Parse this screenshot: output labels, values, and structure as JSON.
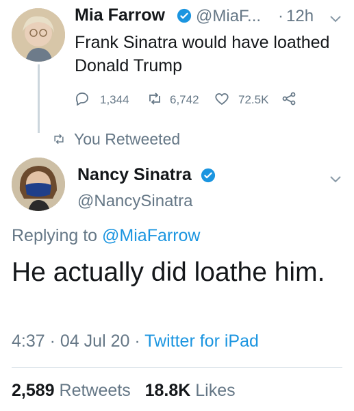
{
  "colors": {
    "accent": "#1b95e0",
    "muted": "#657786",
    "text": "#14171a",
    "divider": "#e1e8ed"
  },
  "tweet1": {
    "author_name": "Mia Farrow",
    "handle": "@MiaF...",
    "separator": "·",
    "time": "12h",
    "text": "Frank Sinatra would have loathed Donald Trump",
    "replies": "1,344",
    "retweets": "6,742",
    "likes": "72.5K",
    "icons": [
      "reply-icon",
      "retweet-icon",
      "like-icon",
      "share-icon",
      "verified-badge-icon",
      "chevron-down-icon"
    ]
  },
  "retweet_banner": {
    "label": "You Retweeted",
    "icon": "retweet-icon"
  },
  "tweet2": {
    "author_name": "Nancy Sinatra",
    "handle": "@NancySinatra",
    "replying_prefix": "Replying to",
    "replying_to": "@MiaFarrow",
    "text": "He actually did loathe him.",
    "time": "4:37",
    "sep1": "·",
    "date": "04 Jul 20",
    "sep2": "·",
    "source": "Twitter for iPad",
    "retweets_count": "2,589",
    "retweets_label": "Retweets",
    "likes_count": "18.8K",
    "likes_label": "Likes"
  }
}
